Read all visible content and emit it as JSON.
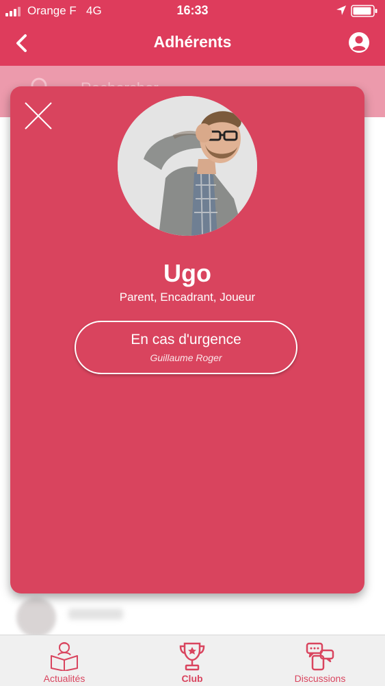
{
  "status_bar": {
    "carrier": "Orange F",
    "network": "4G",
    "time": "16:33"
  },
  "nav": {
    "title": "Adhérents"
  },
  "search": {
    "placeholder": "Rechercher"
  },
  "profile": {
    "name": "Ugo",
    "roles": "Parent, Encadrant, Joueur",
    "emergency_label": "En cas d'urgence",
    "emergency_contact": "Guillaume Roger"
  },
  "tabs": [
    {
      "label": "Actualités",
      "icon": "reading-person-icon",
      "active": false
    },
    {
      "label": "Club",
      "icon": "trophy-icon",
      "active": true
    },
    {
      "label": "Discussions",
      "icon": "chat-bubbles-icon",
      "active": false
    }
  ],
  "colors": {
    "brand": "#DE3C5C",
    "card": "#D9445E",
    "search_bar": "#EC9AAC",
    "tab_bar": "#F0F0F0"
  }
}
